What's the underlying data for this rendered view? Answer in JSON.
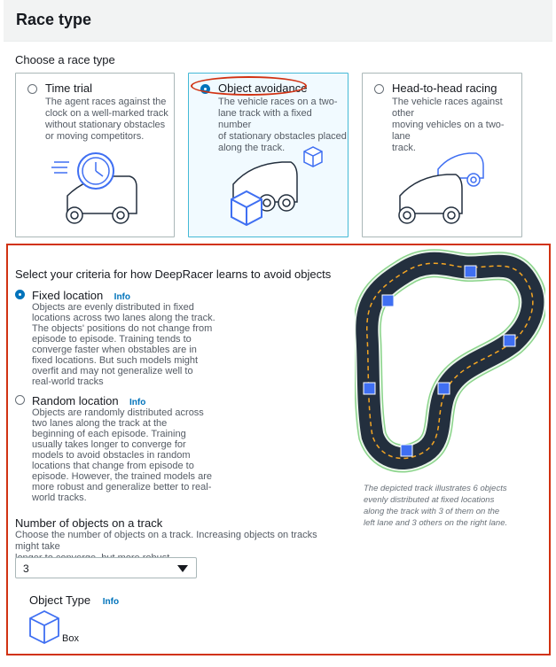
{
  "header": {
    "title": "Race type"
  },
  "choose_label": "Choose a race type",
  "race_types": [
    {
      "title": "Time trial",
      "desc": [
        "The agent races against the",
        "clock on a well-marked track",
        "without stationary obstacles",
        "or moving competitors."
      ],
      "selected": false
    },
    {
      "title": "Object avoidance",
      "desc": [
        "The vehicle races on a two-",
        "lane track with a fixed number",
        "of stationary obstacles placed",
        "along the track."
      ],
      "selected": true
    },
    {
      "title": "Head-to-head racing",
      "desc": [
        "The vehicle races against other",
        "moving vehicles on a two-lane",
        "track."
      ],
      "selected": false
    }
  ],
  "criteria": {
    "heading": "Select your criteria for how DeepRacer learns to avoid objects",
    "fixed": {
      "title": "Fixed location",
      "info": "Info",
      "desc": [
        "Objects are evenly distributed in fixed",
        "locations across two lanes along the track.",
        "The objects' positions do not change from",
        "episode to episode. Training tends to",
        "converge faster when obstables are in",
        "fixed locations. But such models might",
        "overfit and may not generalize well to",
        "real-world tracks"
      ],
      "selected": true
    },
    "random": {
      "title": "Random location",
      "info": "Info",
      "desc": [
        "Objects are randomly distributed across",
        "two lanes along the track at the",
        "beginning of each episode. Training",
        "usually takes longer to converge for",
        "models to avoid obstacles in random",
        "locations that change from episode to",
        "episode. However, the trained models are",
        "more robust and generalize better to real-",
        "world tracks."
      ],
      "selected": false
    }
  },
  "track_caption": [
    "The depicted track illustrates 6 objects",
    "evenly distributed at fixed locations",
    "along the track with 3 of them on the",
    "left lane and 3 others on the right lane."
  ],
  "num_objects": {
    "heading": "Number of objects on a track",
    "desc": [
      "Choose the number of objects on a track. Increasing objects on tracks might take",
      "longer to converge, but more robust."
    ],
    "value": "3"
  },
  "object_type": {
    "heading": "Object Type",
    "info": "Info",
    "label": "Box"
  },
  "colors": {
    "accent": "#0073bb",
    "highlight": "#d13212",
    "selected_bg": "#f1faff",
    "obstacle": "#3f6ff2",
    "track": "#232f3e",
    "lane_line": "#f5a623",
    "track_edge": "#8bd48b"
  }
}
